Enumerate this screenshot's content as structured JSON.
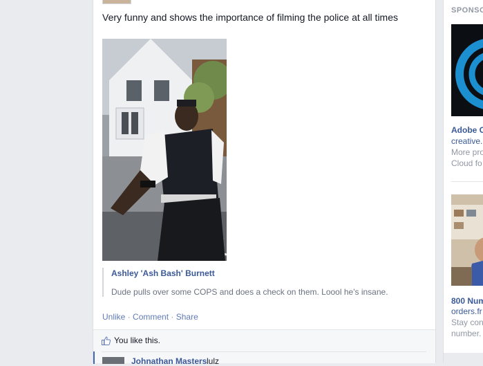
{
  "post": {
    "text": "Very funny and shows the importance of filming the police at all times",
    "link_title": "Ashley 'Ash Bash' Burnett",
    "link_description": "Dude pulls over some COPS and does a check on them. Loool he's insane.",
    "actions": {
      "unlike": "Unlike",
      "comment": "Comment",
      "share": "Share",
      "separator": "·"
    },
    "likes_text": "You like this.",
    "comment": {
      "author": "Johnathan Masters",
      "text": "lulz"
    }
  },
  "sidebar": {
    "sponsored_label": "SPONSO",
    "ads": [
      {
        "title": "Adobe C",
        "link": "creative.",
        "body_line1": "More pro",
        "body_line2": "Cloud fo"
      },
      {
        "title": "800 Num",
        "link": "orders.fr",
        "body_line1": "Stay con",
        "body_line2": "number."
      }
    ]
  },
  "colors": {
    "link_blue": "#3b5998",
    "page_bg": "#e9ebee",
    "accent_blue": "#4267b2"
  }
}
